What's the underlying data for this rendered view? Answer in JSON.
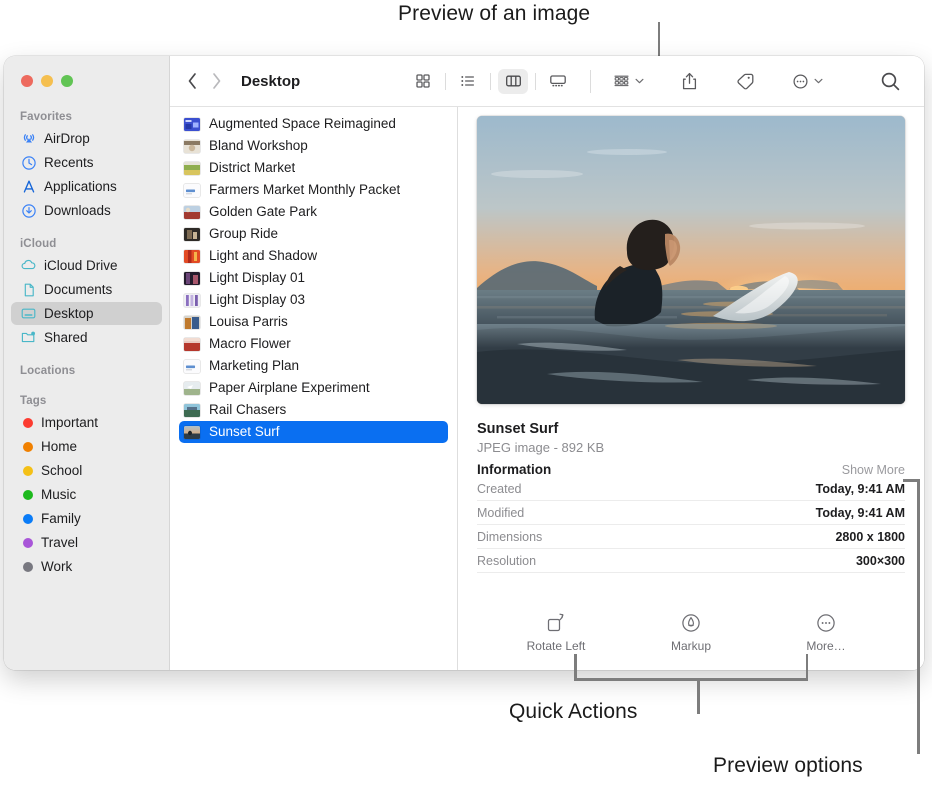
{
  "annotations": [
    {
      "id": "preview-of-an-image",
      "text": "Preview of an image"
    },
    {
      "id": "quick-actions",
      "text": "Quick Actions"
    },
    {
      "id": "preview-options",
      "text": "Preview options"
    }
  ],
  "window": {
    "traffic_lights": [
      "close",
      "minimize",
      "zoom"
    ],
    "toolbar": {
      "back_label": "Back",
      "forward_label": "Forward",
      "breadcrumb": "Desktop",
      "view_modes": [
        {
          "id": "icon-view",
          "label": "Icon View",
          "active": false
        },
        {
          "id": "list-view",
          "label": "List View",
          "active": false
        },
        {
          "id": "column-view",
          "label": "Column View",
          "active": true
        },
        {
          "id": "gallery-view",
          "label": "Gallery View",
          "active": false
        }
      ],
      "group_label": "Group",
      "share_label": "Share",
      "tags_label": "Tags",
      "more_label": "More",
      "search_label": "Search"
    },
    "sidebar": {
      "sections": [
        {
          "header": "Favorites",
          "items": [
            {
              "label": "AirDrop",
              "icon": "airdrop-icon",
              "selected": false
            },
            {
              "label": "Recents",
              "icon": "clock-icon",
              "selected": false
            },
            {
              "label": "Applications",
              "icon": "applications-icon",
              "selected": false
            },
            {
              "label": "Downloads",
              "icon": "downloads-icon",
              "selected": false
            }
          ]
        },
        {
          "header": "iCloud",
          "items": [
            {
              "label": "iCloud Drive",
              "icon": "cloud-icon",
              "selected": false
            },
            {
              "label": "Documents",
              "icon": "document-icon",
              "selected": false
            },
            {
              "label": "Desktop",
              "icon": "desktop-icon",
              "selected": true
            },
            {
              "label": "Shared",
              "icon": "shared-folder-icon",
              "selected": false
            }
          ]
        },
        {
          "header": "Locations",
          "items": []
        },
        {
          "header": "Tags",
          "items": [
            {
              "label": "Important",
              "color": "#fc3b30"
            },
            {
              "label": "Home",
              "color": "#f08000"
            },
            {
              "label": "School",
              "color": "#f4c016"
            },
            {
              "label": "Music",
              "color": "#1db91d"
            },
            {
              "label": "Family",
              "color": "#0a7cf7"
            },
            {
              "label": "Travel",
              "color": "#a855d8"
            },
            {
              "label": "Work",
              "color": "#787880"
            }
          ]
        }
      ]
    },
    "file_list": [
      {
        "name": "Augmented Space Reimagined",
        "thumb": "blue-graphic",
        "selected": false
      },
      {
        "name": "Bland Workshop",
        "thumb": "tan-photo",
        "selected": false
      },
      {
        "name": "District Market",
        "thumb": "green-photo",
        "selected": false
      },
      {
        "name": "Farmers Market Monthly Packet",
        "thumb": "document",
        "selected": false
      },
      {
        "name": "Golden Gate Park",
        "thumb": "red-photo",
        "selected": false
      },
      {
        "name": "Group Ride",
        "thumb": "dark-photo",
        "selected": false
      },
      {
        "name": "Light and Shadow",
        "thumb": "orange-photo",
        "selected": false
      },
      {
        "name": "Light Display 01",
        "thumb": "dark-purple-photo",
        "selected": false
      },
      {
        "name": "Light Display 03",
        "thumb": "violet-stripes",
        "selected": false
      },
      {
        "name": "Louisa Parris",
        "thumb": "portrait-photo",
        "selected": false
      },
      {
        "name": "Macro Flower",
        "thumb": "pink-photo",
        "selected": false
      },
      {
        "name": "Marketing Plan",
        "thumb": "document",
        "selected": false
      },
      {
        "name": "Paper Airplane Experiment",
        "thumb": "pale-photo",
        "selected": false
      },
      {
        "name": "Rail Chasers",
        "thumb": "landscape-photo",
        "selected": false
      },
      {
        "name": "Sunset Surf",
        "thumb": "sunset-photo",
        "selected": true
      }
    ],
    "preview": {
      "image_alt": "Surfer sitting on board at sunset",
      "title": "Sunset Surf",
      "subtitle": "JPEG image - 892 KB",
      "information_header": "Information",
      "show_more_label": "Show More",
      "rows": [
        {
          "key": "Created",
          "value": "Today, 9:41 AM"
        },
        {
          "key": "Modified",
          "value": "Today, 9:41 AM"
        },
        {
          "key": "Dimensions",
          "value": "2800 x 1800"
        },
        {
          "key": "Resolution",
          "value": "300×300"
        }
      ],
      "quick_actions": [
        {
          "label": "Rotate Left",
          "icon": "rotate-left-icon"
        },
        {
          "label": "Markup",
          "icon": "markup-icon"
        },
        {
          "label": "More…",
          "icon": "more-circle-icon"
        }
      ]
    }
  },
  "colors": {
    "selection_blue": "#0a6ff1",
    "sidebar_bg": "#ececec",
    "sidebar_selected": "#d0d0d0",
    "callout_line": "#7d7d7d"
  }
}
